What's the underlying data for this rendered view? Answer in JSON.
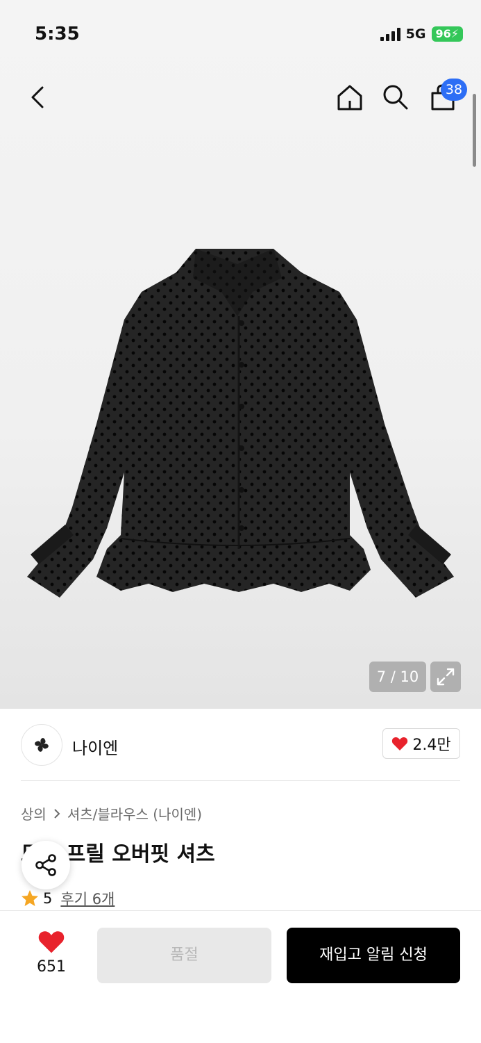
{
  "status_bar": {
    "time": "5:35",
    "network": "5G",
    "battery": "96"
  },
  "nav": {
    "cart_count": "38"
  },
  "gallery": {
    "counter": "7 / 10"
  },
  "brand": {
    "name": "나이엔",
    "like_count": "2.4만"
  },
  "breadcrumb": {
    "category": "상의",
    "subcategory": "셔츠/블라우스 (나이엔)"
  },
  "product": {
    "title": "도트 프릴 오버핏 셔츠",
    "rating": "5",
    "reviews_label": "후기 6개"
  },
  "bottom_bar": {
    "like_count": "651",
    "soldout_label": "품절",
    "restock_label": "재입고 알림 신청"
  },
  "colors": {
    "accent_blue": "#2d6ef5",
    "heart_red": "#e8222c",
    "star_orange": "#f5a623",
    "battery_green": "#34c759"
  },
  "icons": [
    "back-icon",
    "home-icon",
    "search-icon",
    "cart-icon",
    "expand-icon",
    "heart-icon",
    "share-icon",
    "star-icon"
  ]
}
